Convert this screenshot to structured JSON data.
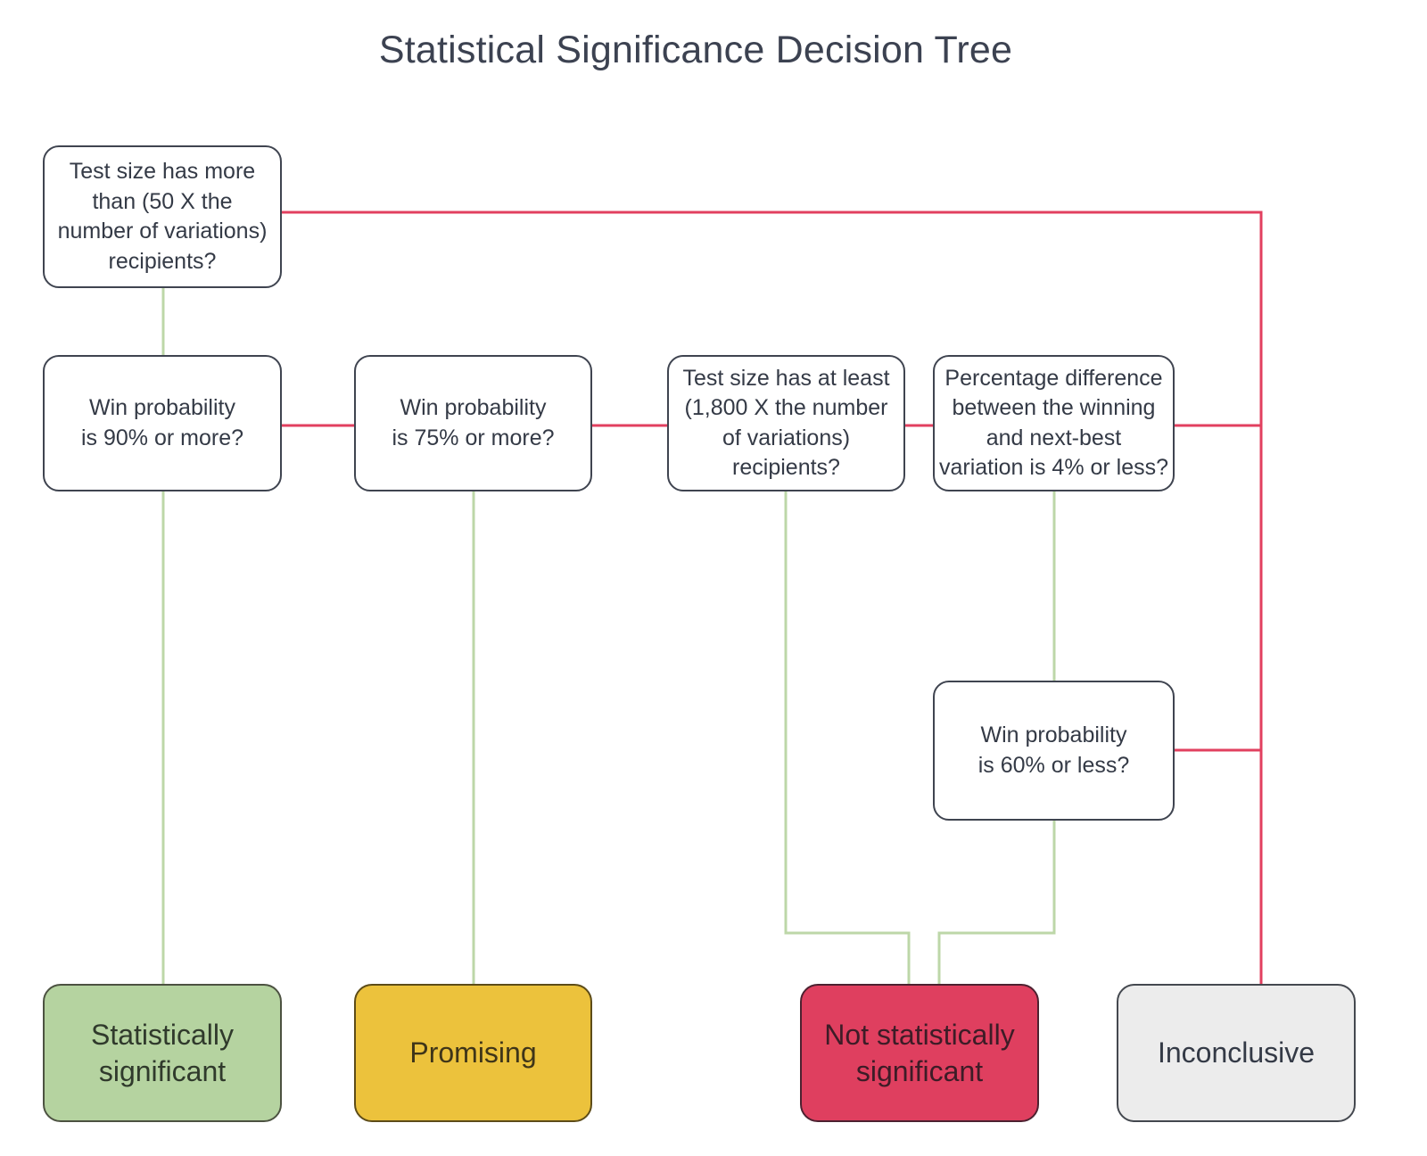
{
  "diagram": {
    "title": "Statistical Significance Decision Tree",
    "type": "decision-tree",
    "colors": {
      "yes_edge": "#bdd7a8",
      "no_edge": "#e2405f",
      "node_border": "#3f4450",
      "node_fill": "#ffffff",
      "text": "#343a46",
      "outcome_green_fill": "#b5d3a0",
      "outcome_amber_fill": "#ecc23c",
      "outcome_crimson_fill": "#df3f5f",
      "outcome_grey_fill": "#ececec",
      "background": "#ffffff"
    }
  },
  "nodes": {
    "q1": {
      "label": "Test size has more\nthan (50 X the\nnumber of variations)\nrecipients?",
      "kind": "decision"
    },
    "q2": {
      "label": "Win probability\nis 90% or more?",
      "kind": "decision"
    },
    "q3": {
      "label": "Win probability\nis 75% or more?",
      "kind": "decision"
    },
    "q4": {
      "label": "Test size has at least\n(1,800 X the number\nof variations)\nrecipients?",
      "kind": "decision"
    },
    "q5": {
      "label": "Percentage difference\nbetween the winning\nand next-best\nvariation is 4% or less?",
      "kind": "decision"
    },
    "q6": {
      "label": "Win probability\nis 60% or less?",
      "kind": "decision"
    },
    "out_significant": {
      "label": "Statistically\nsignificant",
      "kind": "outcome",
      "color": "green"
    },
    "out_promising": {
      "label": "Promising",
      "kind": "outcome",
      "color": "amber"
    },
    "out_not_significant": {
      "label": "Not statistically\nsignificant",
      "kind": "outcome",
      "color": "crimson"
    },
    "out_inconclusive": {
      "label": "Inconclusive",
      "kind": "outcome",
      "color": "grey"
    }
  },
  "edges": [
    {
      "from": "q1",
      "to": "q2",
      "branch": "yes",
      "color": "#bdd7a8"
    },
    {
      "from": "q1",
      "to": "out_inconclusive",
      "branch": "no",
      "color": "#e2405f"
    },
    {
      "from": "q2",
      "to": "out_significant",
      "branch": "yes",
      "color": "#bdd7a8"
    },
    {
      "from": "q2",
      "to": "q3",
      "branch": "no",
      "color": "#e2405f"
    },
    {
      "from": "q3",
      "to": "out_promising",
      "branch": "yes",
      "color": "#bdd7a8"
    },
    {
      "from": "q3",
      "to": "q4",
      "branch": "no",
      "color": "#e2405f"
    },
    {
      "from": "q4",
      "to": "out_not_significant",
      "branch": "yes",
      "color": "#bdd7a8"
    },
    {
      "from": "q4",
      "to": "q5",
      "branch": "no",
      "color": "#e2405f"
    },
    {
      "from": "q5",
      "to": "q6",
      "branch": "yes",
      "color": "#bdd7a8"
    },
    {
      "from": "q5",
      "to": "out_inconclusive",
      "branch": "no",
      "color": "#e2405f"
    },
    {
      "from": "q6",
      "to": "out_not_significant",
      "branch": "yes",
      "color": "#bdd7a8"
    },
    {
      "from": "q6",
      "to": "out_inconclusive",
      "branch": "no",
      "color": "#e2405f"
    }
  ]
}
